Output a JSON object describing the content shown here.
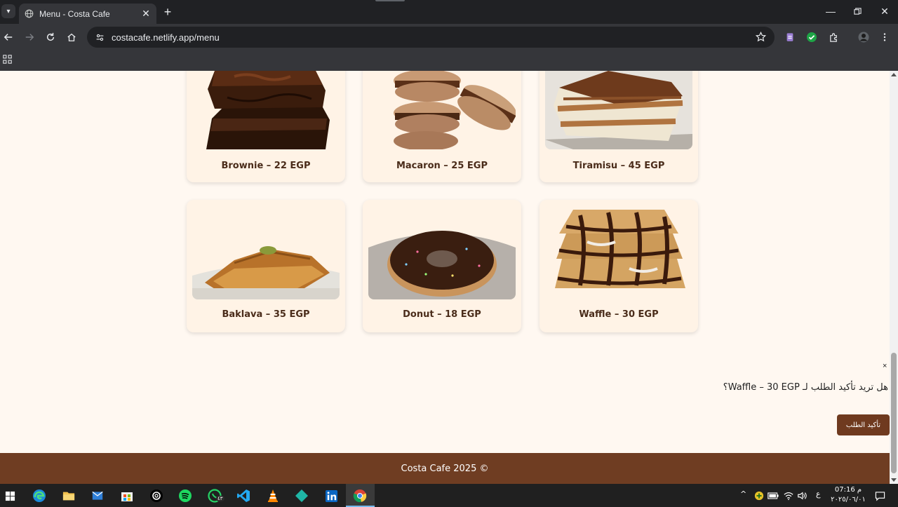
{
  "browser": {
    "tab_title": "Menu - Costa Cafe",
    "url": "costacafe.netlify.app/menu"
  },
  "menu": {
    "items": [
      {
        "label": "Brownie – 22 EGP"
      },
      {
        "label": "Macaron – 25 EGP"
      },
      {
        "label": "Tiramisu – 45 EGP"
      },
      {
        "label": "Baklava – 35 EGP"
      },
      {
        "label": "Donut – 18 EGP"
      },
      {
        "label": "Waffle – 30 EGP"
      }
    ]
  },
  "confirm": {
    "close": "×",
    "text": "هل تريد تأكيد الطلب لـ Waffle – 30 EGP؟",
    "button": "تأكيد الطلب"
  },
  "footer": {
    "text": "Costa Cafe 2025 ©"
  },
  "taskbar": {
    "time": "07:16 م",
    "date": "٢٠٢٥/٠٦/٠١",
    "lang": "ع",
    "whatsapp_badge": "٤٣"
  },
  "colors": {
    "page_bg": "#fff8f1",
    "card_bg": "#fff3e6",
    "brand_brown": "#6f3d22",
    "label_brown": "#4a2c1a"
  }
}
